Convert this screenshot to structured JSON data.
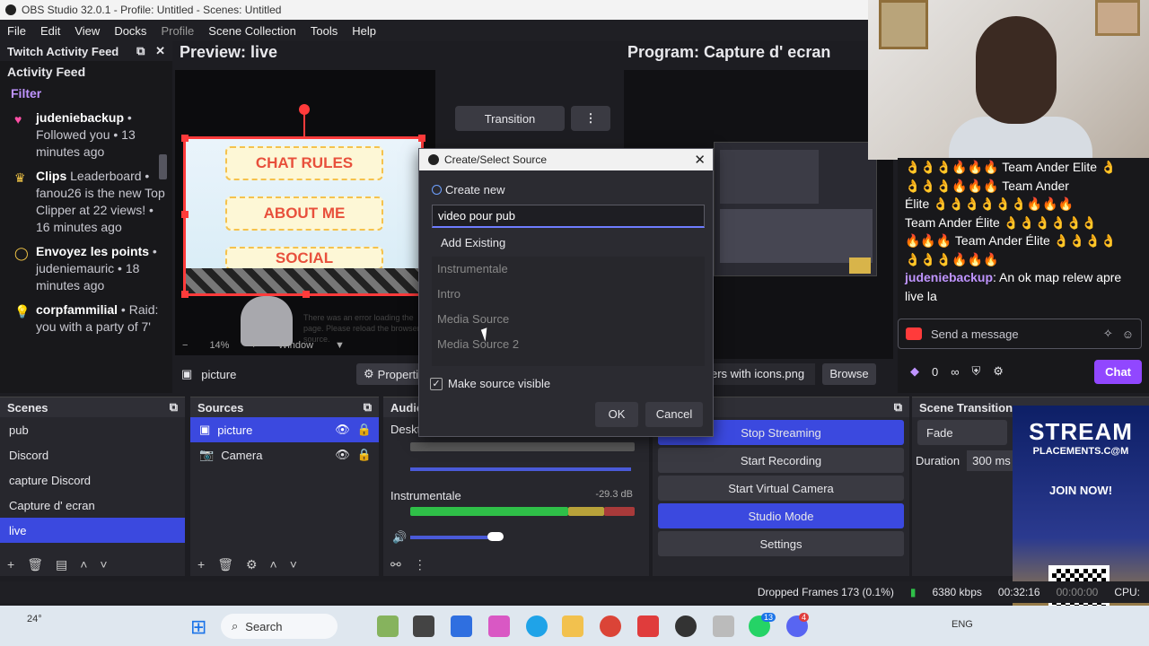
{
  "window": {
    "title": "OBS Studio 32.0.1 - Profile: Untitled - Scenes: Untitled"
  },
  "menu": {
    "items": [
      "File",
      "Edit",
      "View",
      "Docks",
      "Profile",
      "Scene Collection",
      "Tools",
      "Help"
    ]
  },
  "twitch": {
    "dock_title": "Twitch Activity Feed",
    "feed_title": "Activity Feed",
    "filter": "Filter",
    "items": [
      {
        "icon": "heart-icon",
        "bold": "judeniebackup",
        "text": " • Followed you • 13 minutes ago"
      },
      {
        "icon": "crown-icon",
        "bold": "Clips",
        "text": " Leaderboard • fanou26 is the new Top Clipper at 22 views! • 16 minutes ago"
      },
      {
        "icon": "points-icon",
        "bold": "Envoyez les points",
        "text": " • judeniemauric • 18 minutes ago"
      },
      {
        "icon": "bulb-icon",
        "bold": "corpfammilial",
        "text": " • Raid: you with a party of 7'"
      }
    ]
  },
  "preview": {
    "header": "Preview: live",
    "pill1": "CHAT RULES",
    "pill2": "ABOUT ME",
    "pill3": "SOCIAL",
    "ghost_text": "There was an error loading the page. Please reload the browser source.",
    "zoom": "14%",
    "window_label": "Window"
  },
  "program": {
    "header": "Program: Capture d' ecran",
    "transition": "Transition"
  },
  "chat": {
    "lines": [
      "👌👌👌🔥🔥🔥 Team Ander Elite 👌",
      "👌👌👌🔥🔥🔥 Team Ander",
      "Élite 👌👌👌👌👌👌🔥🔥🔥",
      "Team Ander Élite 👌👌👌👌👌👌",
      "🔥🔥🔥 Team Ander Élite 👌👌👌👌",
      "👌👌👌🔥🔥🔥"
    ],
    "msg_user": "judeniebackup",
    "msg_text": ": An ok map relew apre live la",
    "placeholder": "Send a message",
    "points": "0",
    "infinity": "∞",
    "chat_button": "Chat"
  },
  "propbar": {
    "source": "picture",
    "properties": "Properti",
    "file": "ers with icons.png",
    "browse": "Browse"
  },
  "scenes": {
    "title": "Scenes",
    "items": [
      "pub",
      "Discord",
      "capture Discord",
      "Capture d' ecran",
      "live"
    ],
    "selected": 4
  },
  "sources": {
    "title": "Sources",
    "items": [
      "picture",
      "Camera"
    ]
  },
  "audio": {
    "title": "Audio",
    "desktop": "Deskt",
    "track": "Instrumentale",
    "db": "-29.3 dB",
    "scale": [
      "-60",
      "-55",
      "-50",
      "-45",
      "-40",
      "-35",
      "-30",
      "-25",
      "-20",
      "-15",
      "-10",
      "-5",
      "0"
    ]
  },
  "controls": {
    "items": [
      "Stop Streaming",
      "Start Recording",
      "Start Virtual Camera",
      "Studio Mode",
      "Settings"
    ]
  },
  "transitions": {
    "title": "Scene Transitions",
    "type": "Fade",
    "duration_label": "Duration",
    "duration": "300 ms"
  },
  "status": {
    "frames": "Dropped Frames 173 (0.1%)",
    "kbps": "6380 kbps",
    "live_time": "00:32:16",
    "rec_time": "00:00:00",
    "cpu": "CPU:"
  },
  "taskbar": {
    "weather": "24°",
    "search": "Search",
    "lang": "ENG",
    "badge1": "13",
    "badge2": "4"
  },
  "ad": {
    "brand": "STREAM",
    "sub": "PLACEMENTS.C@M",
    "cta": "JOIN NOW!"
  },
  "dialog": {
    "title": "Create/Select Source",
    "create_new": "Create new",
    "name_value": "video pour pub",
    "add_existing": "Add Existing",
    "existing": [
      "Instrumentale",
      "Intro",
      "Media Source",
      "Media Source 2"
    ],
    "visible": "Make source visible",
    "ok": "OK",
    "cancel": "Cancel"
  },
  "colors": {
    "accent": "#3b49df",
    "twitch": "#9147ff",
    "selection": "#ff3b3b"
  }
}
